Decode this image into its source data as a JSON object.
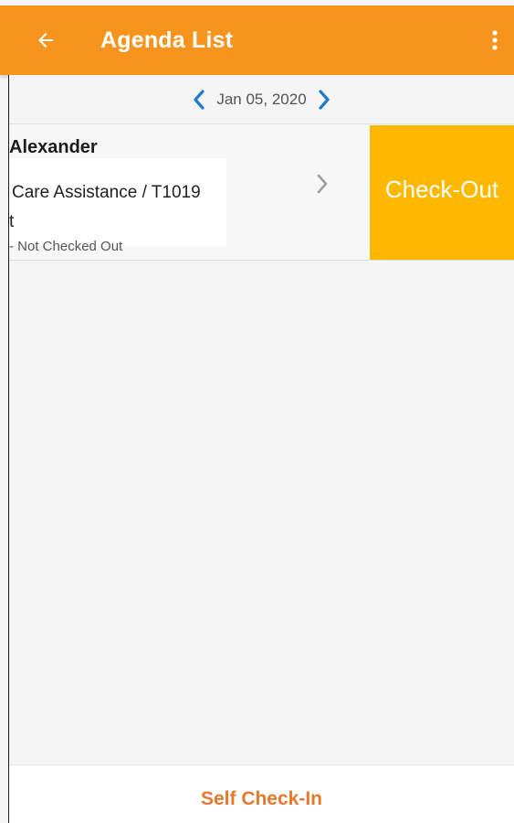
{
  "appbar": {
    "title": "Agenda List",
    "back_icon": "arrow-left-icon",
    "menu_icon": "more-vertical-icon",
    "color": "#F7941D"
  },
  "date_nav": {
    "date": "Jan 05, 2020",
    "prev_icon": "chevron-left-icon",
    "next_icon": "chevron-right-icon",
    "arrow_color": "#1E7CC8"
  },
  "agenda": {
    "items": [
      {
        "name": "Alexander",
        "service": "Care Assistance / T1019",
        "line3": "t",
        "status": "- Not Checked Out",
        "action_label": "Check-Out",
        "action_color": "#FFB800"
      }
    ]
  },
  "footer": {
    "self_checkin_label": "Self Check-In",
    "color": "#E8772E"
  }
}
